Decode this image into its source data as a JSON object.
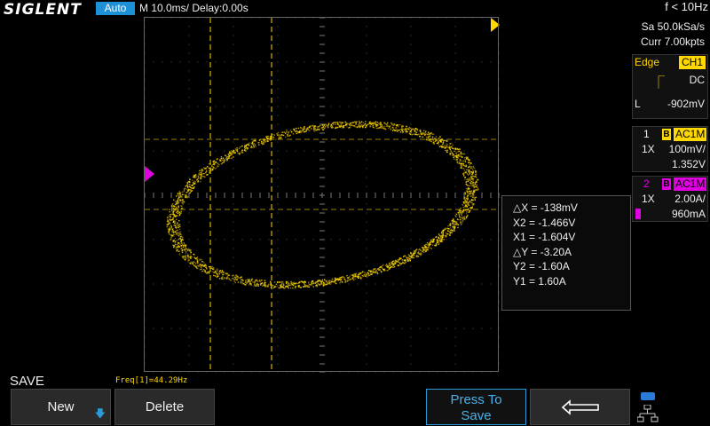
{
  "topbar": {
    "logo": "SIGLENT",
    "trigger_mode": "Auto",
    "timebase": "M 10.0ms/ Delay:0.00s",
    "freq_indicator": "f < 10Hz"
  },
  "acquisition": {
    "sample_rate": "Sa 50.0kSa/s",
    "memory_depth": "Curr 7.00kpts"
  },
  "trigger": {
    "type": "Edge",
    "source": "CH1",
    "coupling": "DC",
    "level_label": "L",
    "level": "-902mV"
  },
  "channels": [
    {
      "number": "1",
      "bw_label": "B",
      "coupling": "AC1M",
      "probe": "1X",
      "scale": "100mV/",
      "offset": "1.352V",
      "color": "#ffd800"
    },
    {
      "number": "2",
      "bw_label": "B",
      "coupling": "AC1M",
      "probe": "1X",
      "scale": "2.00A/",
      "offset": "960mA",
      "color": "#e000e0"
    }
  ],
  "cursors": {
    "dx": "△X = -138mV",
    "x2": "X2 = -1.466V",
    "x1": "X1 = -1.604V",
    "dy": "△Y = -3.20A",
    "y2": "Y2 = -1.60A",
    "y1": "Y1 = 1.60A"
  },
  "measure": {
    "freq": "Freq[1]=44.29Hz"
  },
  "menu": {
    "title": "SAVE",
    "new_label": "New",
    "delete_label": "Delete",
    "press_to_save": "Press To",
    "press_to_save_2": "Save"
  },
  "colors": {
    "ch1": "#ffd800",
    "ch2": "#e000e0",
    "accent": "#1e90d8"
  }
}
